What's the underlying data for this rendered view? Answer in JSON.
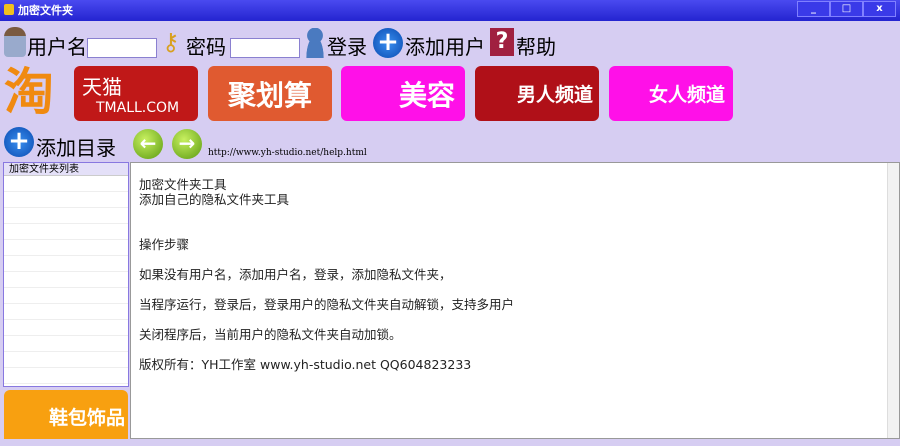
{
  "window": {
    "title": "加密文件夹",
    "min": "_",
    "max": "□",
    "close": "x"
  },
  "toolbar": {
    "username_label": "用户名",
    "username_value": "",
    "password_label": "密码",
    "password_value": "",
    "login": "登录",
    "add_user": "添加用户",
    "help": "帮助"
  },
  "banners": {
    "taobao": "淘",
    "tmall_cn": "天猫",
    "tmall_en": "TMALL.COM",
    "juhuasuan": "聚划算",
    "beauty": "美容",
    "men": "男人频道",
    "women": "女人频道",
    "bags": "鞋包饰品"
  },
  "nav": {
    "add_dir": "添加目录",
    "back": "←",
    "forward": "→",
    "url": "http://www.yh-studio.net/help.html"
  },
  "list": {
    "header": "加密文件夹列表"
  },
  "content": {
    "lines": [
      "加密文件夹工具",
      "添加自己的隐私文件夹工具",
      "操作步骤",
      "如果没有用户名，添加用户名，登录，添加隐私文件夹，",
      "当程序运行，登录后，登录用户的隐私文件夹自动解锁，支持多用户",
      "关闭程序后，当前用户的隐私文件夹自动加锁。",
      "版权所有：YH工作室 www.yh-studio.net QQ604823233"
    ]
  }
}
